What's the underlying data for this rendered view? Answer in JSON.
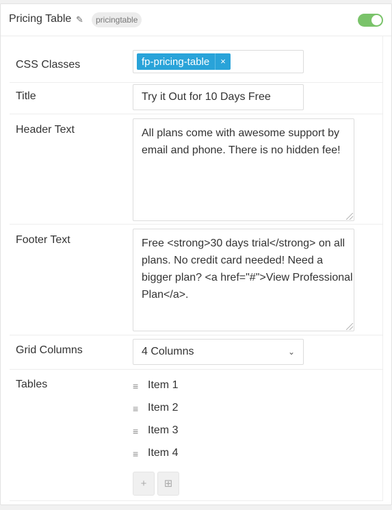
{
  "header": {
    "title": "Pricing Table",
    "badge": "pricingtable",
    "toggle_on": true,
    "accent_color": "#7ac36a"
  },
  "fields": {
    "css_classes": {
      "label": "CSS Classes",
      "tag": "fp-pricing-table",
      "tag_remove": "×"
    },
    "title": {
      "label": "Title",
      "value": "Try it Out for 10 Days Free"
    },
    "header_text": {
      "label": "Header Text",
      "value": "All plans come with awesome support by email and phone. There is no hidden fee!"
    },
    "footer_text": {
      "label": "Footer Text",
      "value": "Free <strong>30 days trial</strong> on all plans. No credit card needed! Need a bigger plan? <a href=\"#\">View Professional Plan</a>."
    },
    "grid_columns": {
      "label": "Grid Columns",
      "value": "4 Columns"
    },
    "tables": {
      "label": "Tables",
      "items": [
        "Item 1",
        "Item 2",
        "Item 3",
        "Item 4"
      ]
    }
  },
  "buttons": {
    "add": "+",
    "grid": "⊞"
  },
  "icons": {
    "edit": "pencil-icon",
    "drag": "drag-handle-icon",
    "chevron": "chevron-down-icon"
  }
}
